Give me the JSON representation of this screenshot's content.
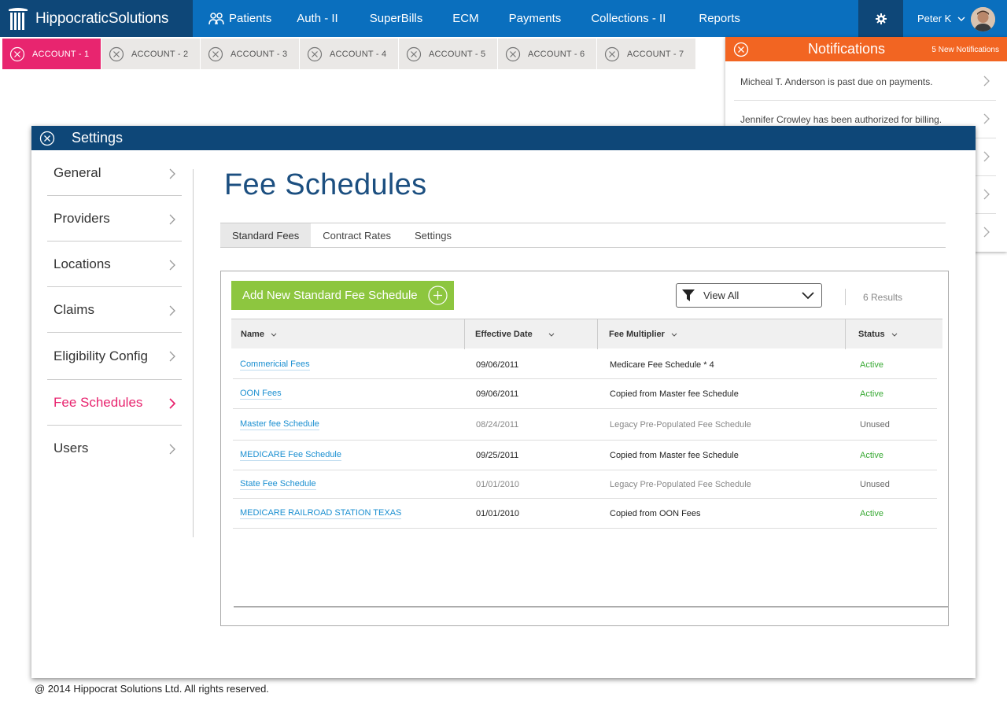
{
  "app": {
    "brand_light": "Hippocratic",
    "brand_bold": "Solutions"
  },
  "nav": {
    "items": [
      "Patients",
      "Auth - II",
      "SuperBills",
      "ECM",
      "Payments",
      "Collections - II",
      "Reports"
    ],
    "user_name": "Peter K"
  },
  "accounts": [
    "ACCOUNT - 1",
    "ACCOUNT - 2",
    "ACCOUNT - 3",
    "ACCOUNT - 4",
    "ACCOUNT - 5",
    "ACCOUNT - 6",
    "ACCOUNT - 7"
  ],
  "notifications": {
    "title": "Notifications",
    "count_label": "5 New Notifications",
    "items": [
      "Micheal T. Anderson is past due on payments.",
      "Jennifer Crowley has been authorized for billing.",
      "",
      "",
      ""
    ]
  },
  "settings": {
    "title": "Settings",
    "sidebar": [
      "General",
      "Providers",
      "Locations",
      "Claims",
      "Eligibility Config",
      "Fee Schedules",
      "Users"
    ],
    "active_sidebar": "Fee Schedules"
  },
  "page": {
    "title": "Fee Schedules",
    "tabs": [
      "Standard Fees",
      "Contract Rates",
      "Settings"
    ],
    "active_tab": "Standard Fees",
    "add_button": "Add New Standard Fee Schedule",
    "filter_value": "View All",
    "results": "6 Results"
  },
  "table": {
    "headers": [
      "Name",
      "Effective Date",
      "Fee Multiplier",
      "Status"
    ],
    "rows": [
      {
        "name": "Commericial Fees",
        "date": "09/06/2011",
        "multiplier": "Medicare Fee Schedule * 4",
        "status": "Active"
      },
      {
        "name": "OON Fees",
        "date": "09/06/2011",
        "multiplier": "Copied from Master fee Schedule",
        "status": "Active"
      },
      {
        "name": "Master fee Schedule",
        "date": "08/24/2011",
        "multiplier": "Legacy Pre-Populated Fee Schedule",
        "status": "Unused"
      },
      {
        "name": "MEDICARE Fee Schedule",
        "date": "09/25/2011",
        "multiplier": "Copied from Master fee Schedule",
        "status": "Active"
      },
      {
        "name": "State Fee Schedule",
        "date": "01/01/2010",
        "multiplier": "Legacy Pre-Populated Fee Schedule",
        "status": "Unused"
      },
      {
        "name": "MEDICARE RAILROAD STATION TEXAS",
        "date": "01/01/2010",
        "multiplier": "Copied from OON Fees",
        "status": "Active"
      }
    ]
  },
  "footer": "@ 2014 Hippocrat Solutions Ltd. All rights reserved.",
  "colors": {
    "brand_dark": "#0e4778",
    "nav_blue": "#0a6fbe",
    "accent_pink": "#e8256f",
    "notif_orange": "#f26522",
    "add_green": "#8dc63f",
    "status_active": "#3aaa35"
  }
}
